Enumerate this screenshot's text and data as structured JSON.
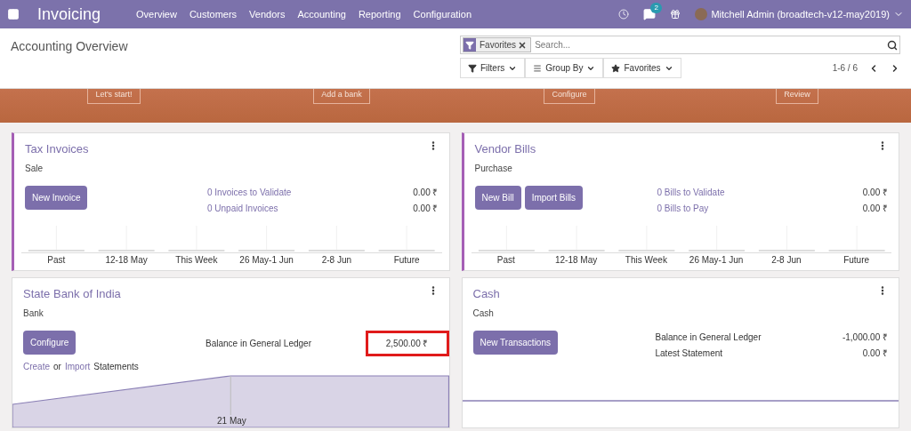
{
  "navbar": {
    "app_name": "Invoicing",
    "menu": [
      "Overview",
      "Customers",
      "Vendors",
      "Accounting",
      "Reporting",
      "Configuration"
    ],
    "message_count": "2",
    "user": "Mitchell Admin (broadtech-v12-may2019)"
  },
  "control_panel": {
    "title": "Accounting Overview",
    "facet": "Favorites",
    "search": {
      "placeholder": "Search..."
    },
    "buttons": [
      "Filters",
      "Group By",
      "Favorites"
    ],
    "pager": "1-6 / 6"
  },
  "banner": {
    "buttons": [
      "Let's start!",
      "Add a bank",
      "Configure",
      "Review"
    ]
  },
  "cards": [
    {
      "title": "Tax Invoices",
      "subtitle": "Sale",
      "accent": true,
      "buttons": [
        "New Invoice"
      ],
      "stats": [
        {
          "kind": "link",
          "label": "0 Invoices to Validate",
          "value": "0.00 ₹",
          "highlighted": false
        },
        {
          "kind": "link",
          "label": "0 Unpaid Invoices",
          "value": "0.00 ₹",
          "highlighted": false
        }
      ],
      "graph": {
        "kind": "bar",
        "x_labels": [
          "Past",
          "12-18 May",
          "This Week",
          "26 May-1 Jun",
          "2-8 Jun",
          "Future"
        ]
      }
    },
    {
      "title": "Vendor Bills",
      "subtitle": "Purchase",
      "accent": true,
      "buttons": [
        "New Bill",
        "Import Bills"
      ],
      "stats": [
        {
          "kind": "link",
          "label": "0 Bills to Validate",
          "value": "0.00 ₹",
          "highlighted": false
        },
        {
          "kind": "link",
          "label": "0 Bills to Pay",
          "value": "0.00 ₹",
          "highlighted": false
        }
      ],
      "graph": {
        "kind": "bar",
        "x_labels": [
          "Past",
          "12-18 May",
          "This Week",
          "26 May-1 Jun",
          "2-8 Jun",
          "Future"
        ]
      }
    },
    {
      "title": "State Bank of India",
      "subtitle": "Bank",
      "accent": false,
      "buttons": [
        "Configure"
      ],
      "statement_links": {
        "create": "Create",
        "or": "or",
        "import": "Import",
        "suffix": "Statements"
      },
      "stats": [
        {
          "kind": "plain",
          "label": "Balance in General Ledger",
          "value": "2,500.00 ₹",
          "highlighted": true
        }
      ],
      "graph": {
        "kind": "line",
        "x_labels": [
          "21 May"
        ]
      }
    },
    {
      "title": "Cash",
      "subtitle": "Cash",
      "accent": false,
      "buttons": [
        "New Transactions"
      ],
      "stats": [
        {
          "kind": "plain",
          "label": "Balance in General Ledger",
          "value": "-1,000.00 ₹",
          "highlighted": false
        },
        {
          "kind": "plain",
          "label": "Latest Statement",
          "value": "0.00 ₹",
          "highlighted": false
        }
      ],
      "graph": {
        "kind": "flat"
      }
    }
  ]
}
